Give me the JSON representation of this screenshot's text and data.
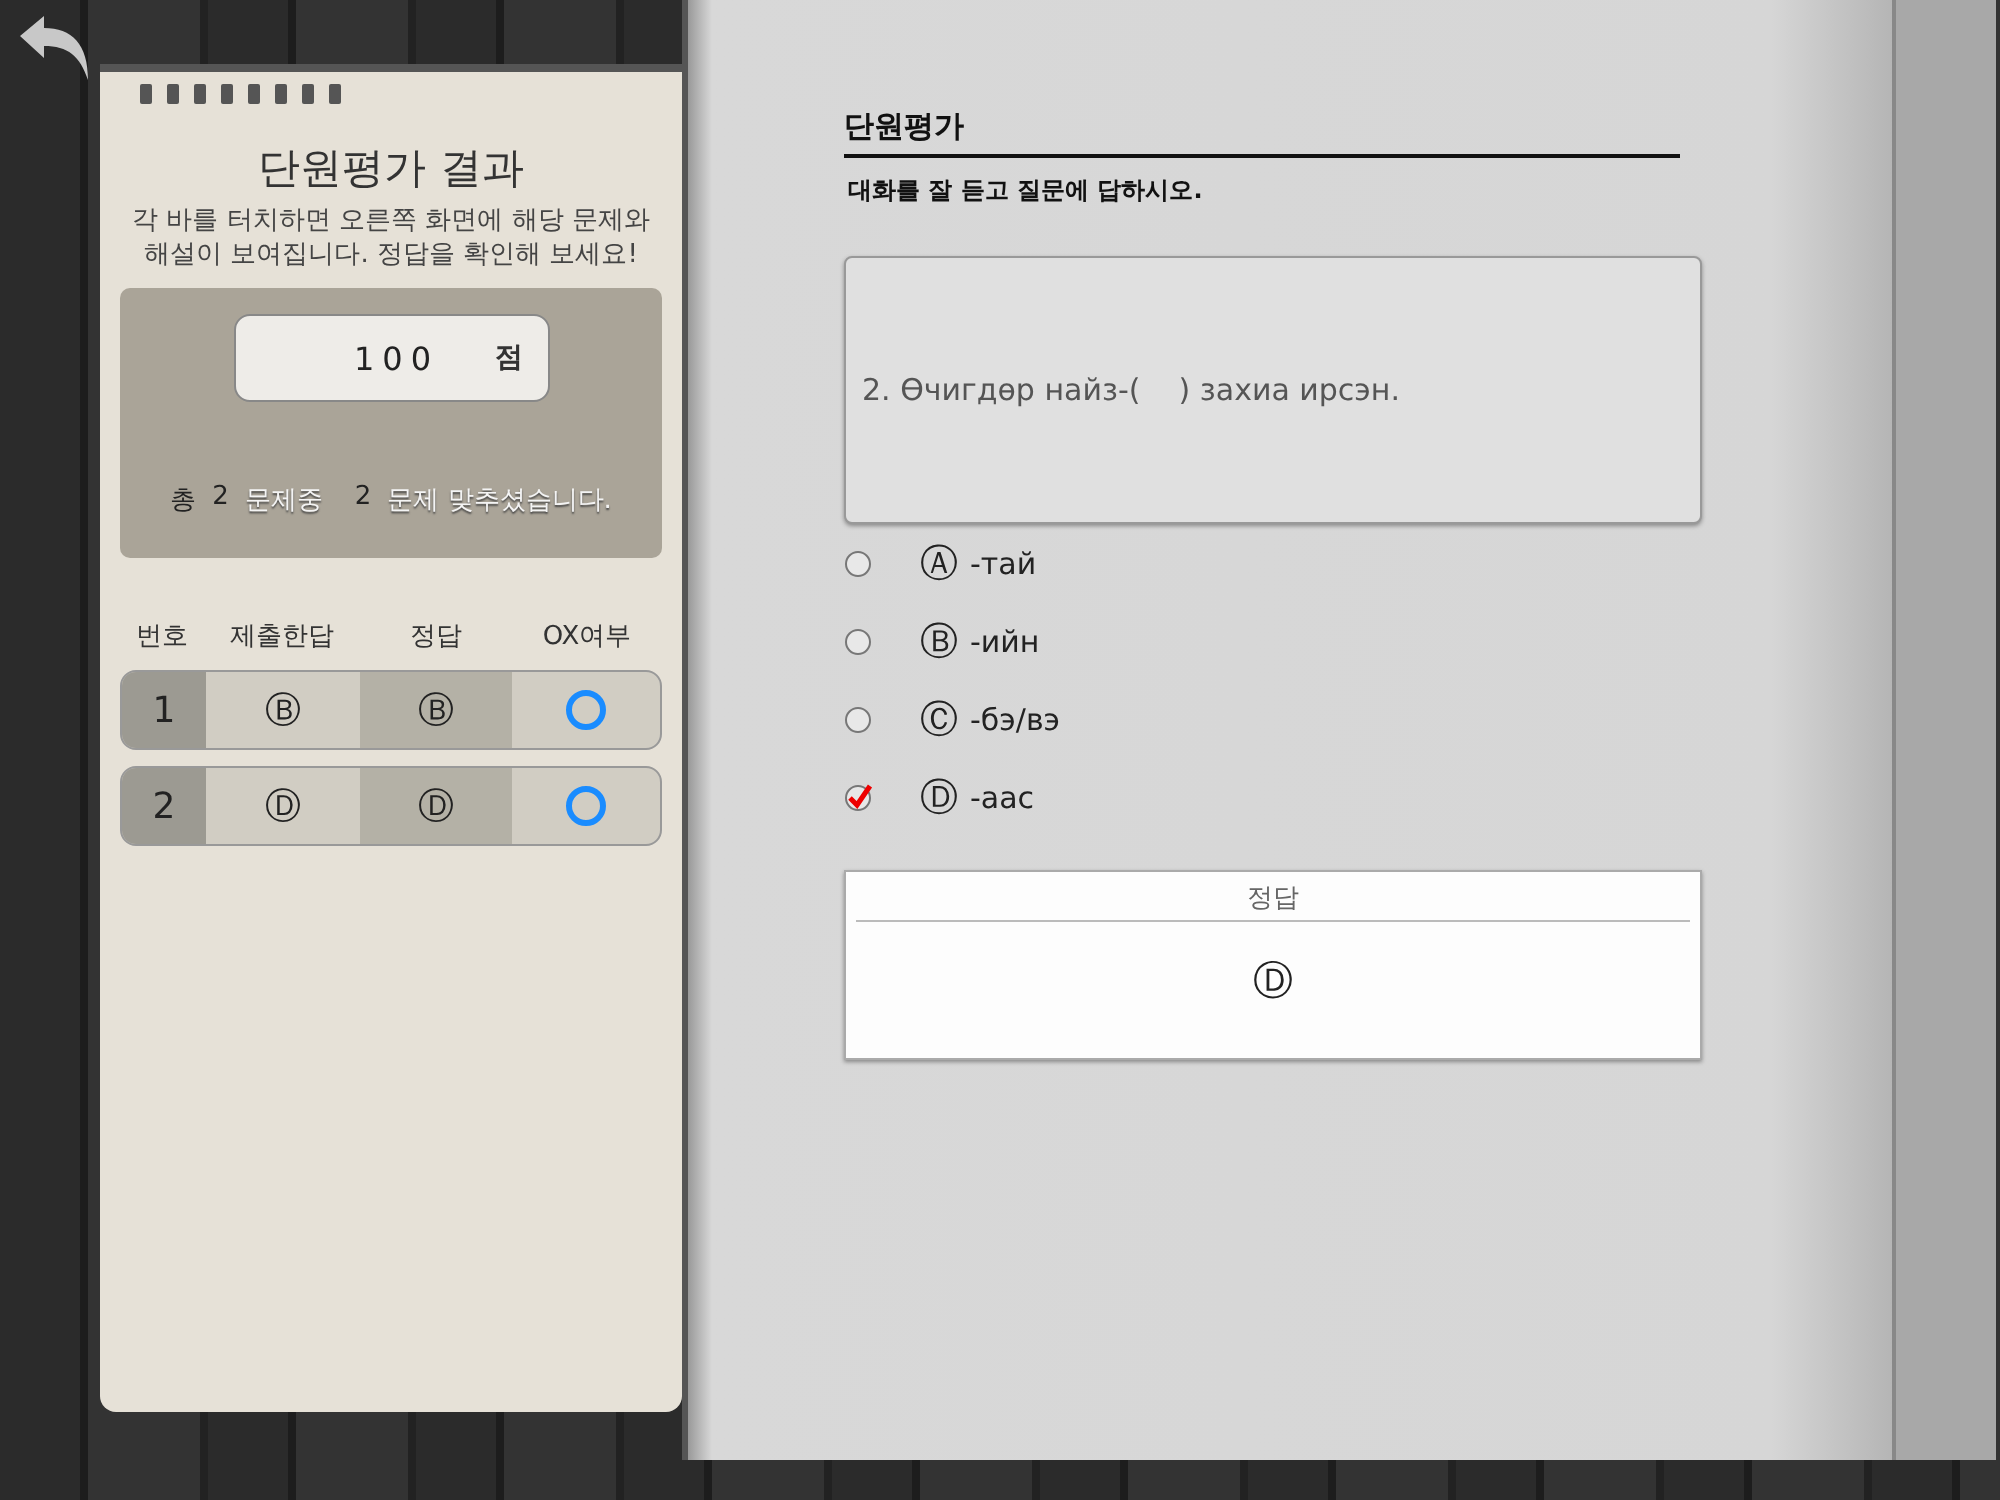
{
  "result_panel": {
    "title": "단원평가 결과",
    "description": "각 바를 터치하면 오른쪽 화면에 해당 문제와 해설이 보여집니다. 정답을 확인해 보세요!",
    "score": {
      "value": "100",
      "unit": "점"
    },
    "summary": {
      "total_label": "총",
      "total": "2",
      "total_unit": "문제중",
      "correct": "2",
      "correct_label": "문제 맞추셨습니다."
    },
    "table": {
      "columns": [
        "번호",
        "제출한답",
        "정답",
        "OX여부"
      ],
      "rows": [
        {
          "number": "1",
          "submitted": "Ⓑ",
          "answer": "Ⓑ",
          "correct": true
        },
        {
          "number": "2",
          "submitted": "Ⓓ",
          "answer": "Ⓓ",
          "correct": true
        }
      ]
    }
  },
  "page": {
    "section_title": "단원평가",
    "instruction": "대화를 잘 듣고 질문에 답하시오.",
    "question": "2. Өчигдөр найз-(    ) захиа ирсэн.",
    "options": [
      {
        "letter": "Ⓐ",
        "text": "-тай",
        "checked": false
      },
      {
        "letter": "Ⓑ",
        "text": "-ийн",
        "checked": false
      },
      {
        "letter": "Ⓒ",
        "text": "-бэ/вэ",
        "checked": false
      },
      {
        "letter": "Ⓓ",
        "text": "-аас",
        "checked": true
      }
    ],
    "answer_box": {
      "label": "정답",
      "answer": "Ⓓ"
    }
  }
}
